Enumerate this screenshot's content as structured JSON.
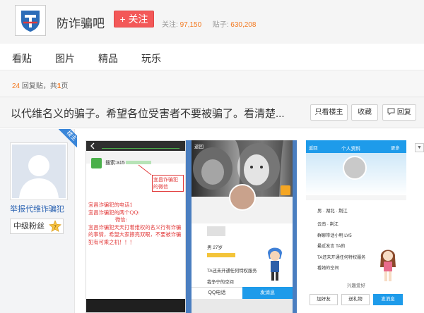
{
  "header": {
    "forum_name": "防诈骗吧",
    "follow_label": "+ 关注",
    "followers_label": "关注:",
    "followers_count": "97,150",
    "posts_label": "贴子:",
    "posts_count": "630,208"
  },
  "nav": {
    "items": [
      "看贴",
      "图片",
      "精品",
      "玩乐"
    ]
  },
  "reply_info": {
    "reply_count": "24",
    "reply_text": "回复贴，共",
    "page_count": "1",
    "page_text": "页"
  },
  "thread": {
    "title": "以代维名义的骗子。希望各位受害者不要被骗了。看清楚...",
    "only_op_label": "只看楼主",
    "favorite_label": "收藏",
    "reply_label": "回复"
  },
  "post": {
    "op_tag": "楼主",
    "author_name": "举报代维诈骗犯",
    "level_title": "中级粉丝",
    "level_num": "7"
  },
  "screenshot1": {
    "search_prefix": "搜索:",
    "search_value": "a15",
    "annotation": "宜昌诈骗犯的微信",
    "lines": [
      "宜昌诈骗犯的电话1",
      "宜昌诈骗犯的两个QQ:",
      "微信:",
      "宜昌诈骗犯天天打着维权的名义行有诈骗的事情，希望大家擦亮双眼，不要被诈骗犯有可乘之机！！！"
    ]
  },
  "screenshot2": {
    "back": "返回",
    "age": "男 27岁",
    "tag": "TA还未开通任何特权服务",
    "space": "我争宁的空间",
    "qq_btn": "QQ电话",
    "msg_btn": "发消息"
  },
  "screenshot3": {
    "back": "返回",
    "title": "个人资料",
    "more": "更多",
    "location": "男 · 湖北 · 荆江",
    "rows": [
      "云南 · 荆江",
      "群聊带话小明 LV5",
      "最近发言 TA的",
      "TA还未开通任何特权服务",
      "看她的空间"
    ],
    "hobby": "兴趣爱好",
    "btn_add": "加好友",
    "btn_gift": "送礼物",
    "btn_msg": "发消息"
  },
  "colors": {
    "accent_red": "#f35858",
    "count_orange": "#f47920",
    "link_blue": "#2d64b3"
  }
}
